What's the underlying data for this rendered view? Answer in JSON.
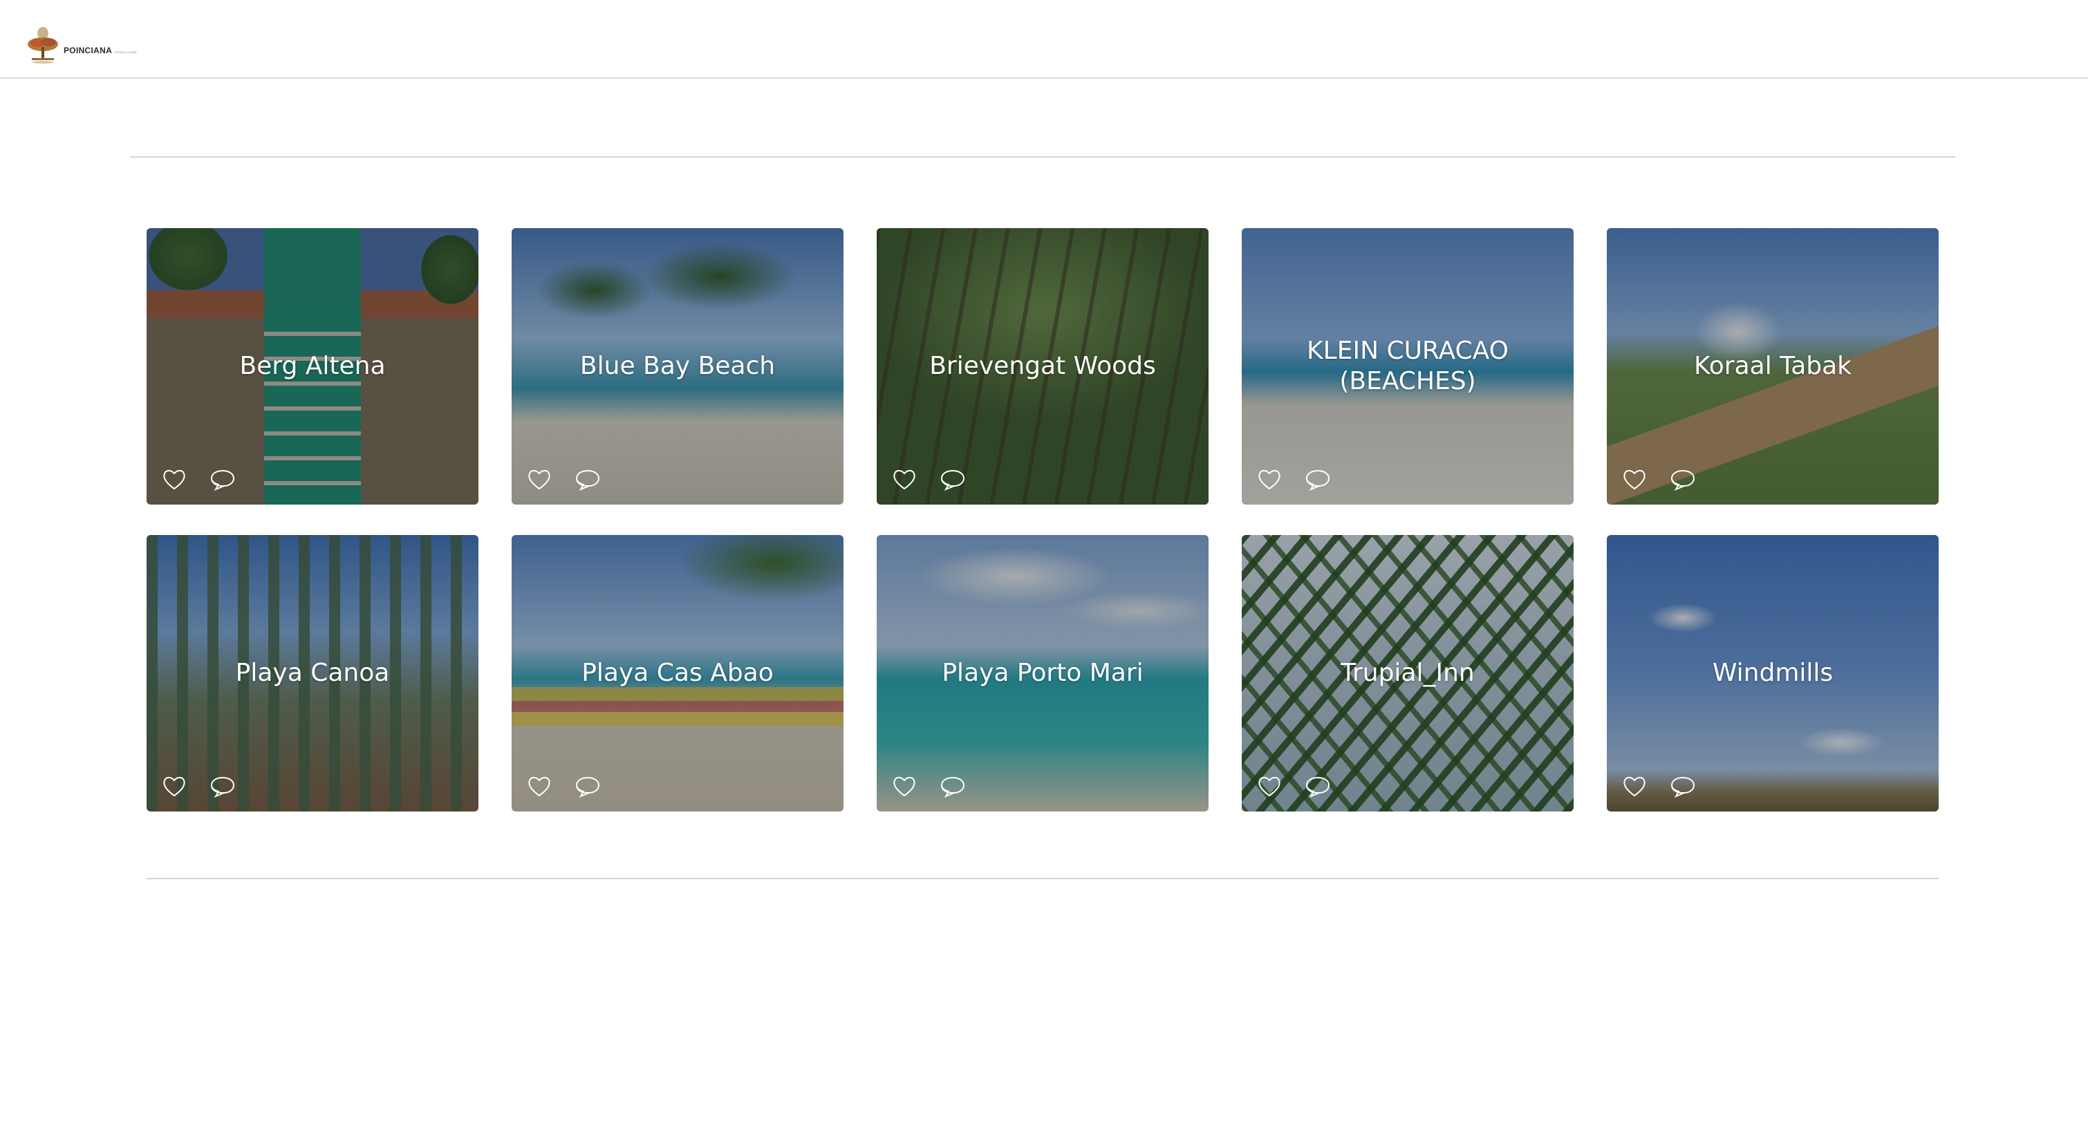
{
  "header": {
    "logo_text": "POINCIANA",
    "logo_subtext": "PRODUCTIONS"
  },
  "gallery": {
    "items": [
      {
        "title": "Berg Altena"
      },
      {
        "title": "Blue Bay Beach"
      },
      {
        "title": "Brievengat Woods"
      },
      {
        "title": "KLEIN CURACAO (BEACHES)"
      },
      {
        "title": "Koraal Tabak"
      },
      {
        "title": "Playa Canoa"
      },
      {
        "title": "Playa Cas Abao"
      },
      {
        "title": "Playa Porto Mari"
      },
      {
        "title": "Trupial_Inn"
      },
      {
        "title": "Windmills"
      }
    ]
  },
  "icons": {
    "like": "heart-icon",
    "comment": "comment-icon"
  }
}
